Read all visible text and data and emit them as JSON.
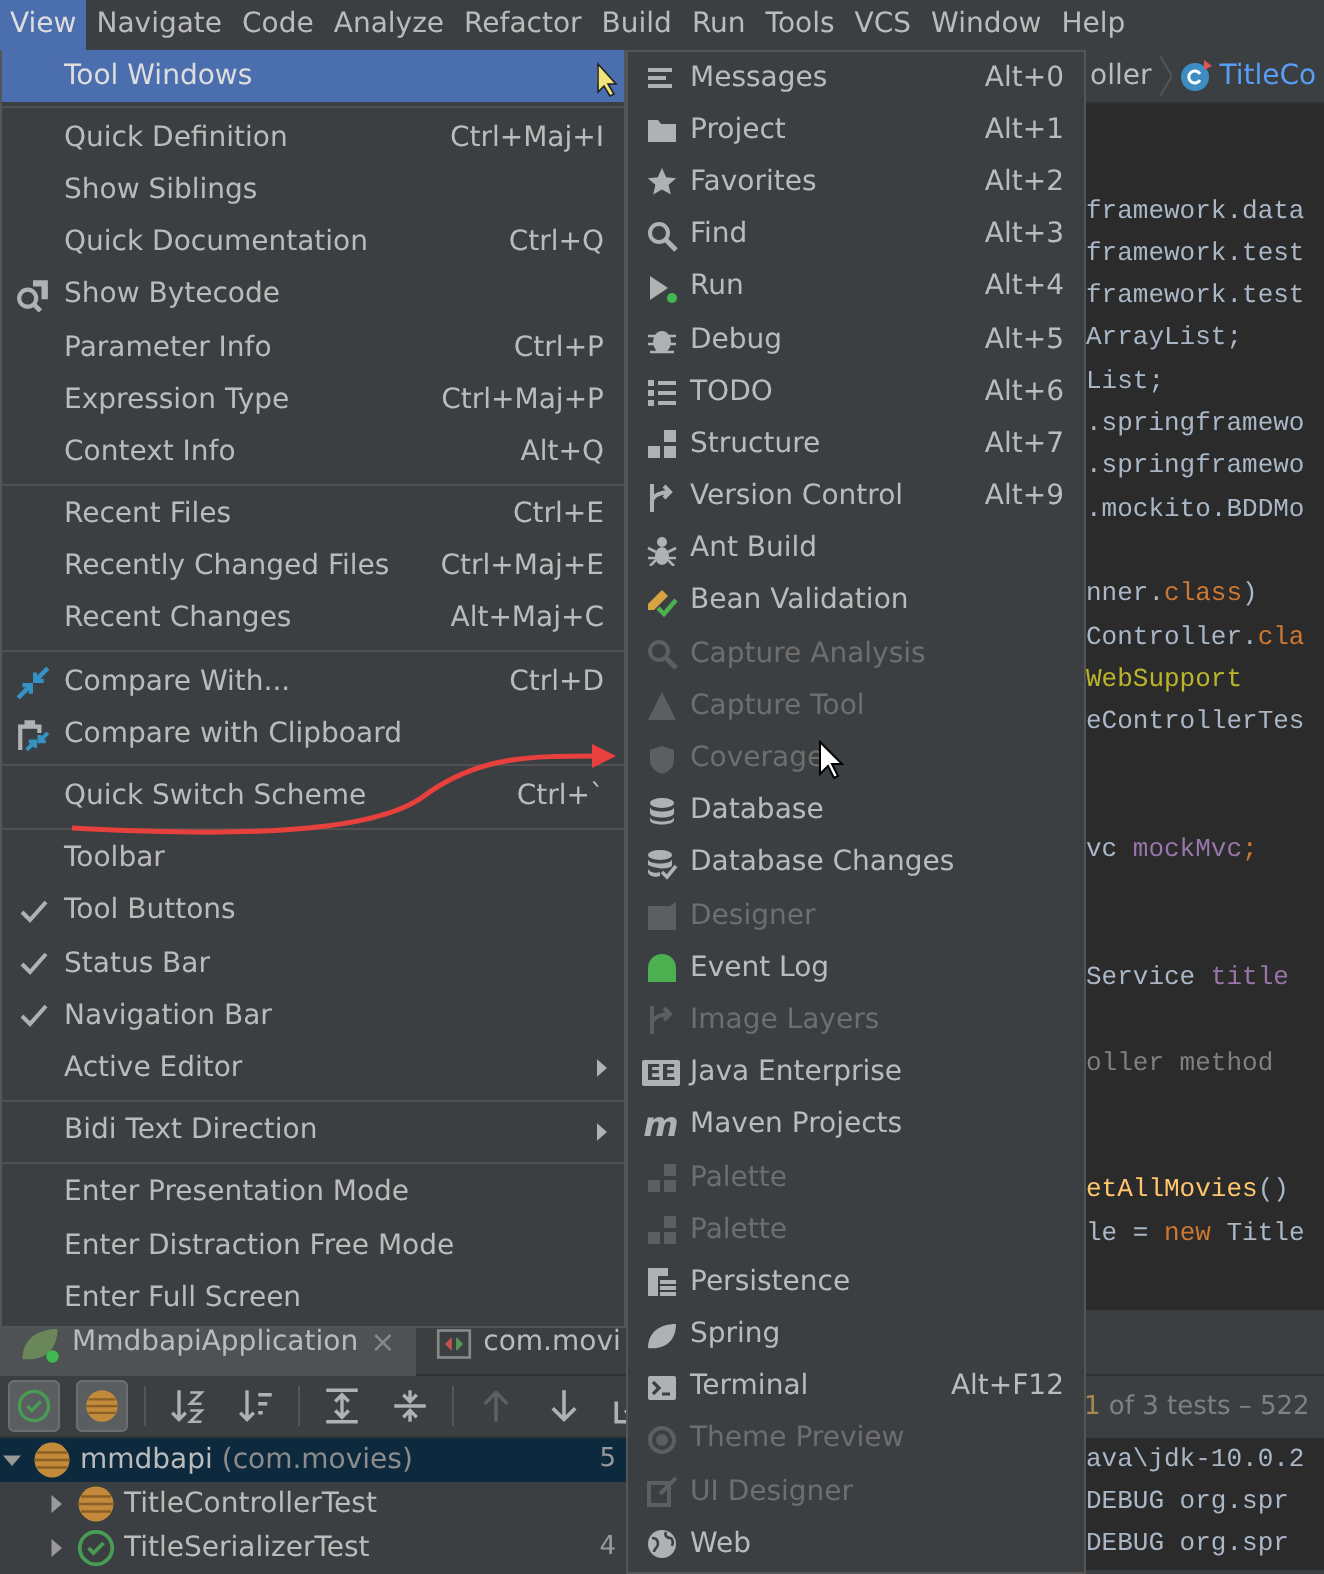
{
  "menu_bar": [
    {
      "label": "View",
      "selected": true
    },
    {
      "label": "Navigate",
      "selected": false
    },
    {
      "label": "Code",
      "selected": false
    },
    {
      "label": "Analyze",
      "selected": false
    },
    {
      "label": "Refactor",
      "selected": false
    },
    {
      "label": "Build",
      "selected": false
    },
    {
      "label": "Run",
      "selected": false
    },
    {
      "label": "Tools",
      "selected": false
    },
    {
      "label": "VCS",
      "selected": false
    },
    {
      "label": "Window",
      "selected": false
    },
    {
      "label": "Help",
      "selected": false
    }
  ],
  "view_menu": {
    "groups": [
      [
        {
          "label": "Tool Windows",
          "kind": "submenu",
          "selected": true
        }
      ],
      [
        {
          "label": "Quick Definition",
          "shortcut": "Ctrl+Maj+I",
          "kind": "action",
          "selected": false
        },
        {
          "label": "Show Siblings",
          "kind": "action",
          "selected": false
        },
        {
          "label": "Quick Documentation",
          "shortcut": "Ctrl+Q",
          "kind": "action",
          "selected": false
        },
        {
          "label": "Show Bytecode",
          "kind": "action",
          "selected": false
        },
        {
          "label": "Parameter Info",
          "shortcut": "Ctrl+P",
          "kind": "action",
          "selected": false
        },
        {
          "label": "Expression Type",
          "shortcut": "Ctrl+Maj+P",
          "kind": "action",
          "selected": false
        },
        {
          "label": "Context Info",
          "shortcut": "Alt+Q",
          "kind": "action",
          "selected": false
        }
      ],
      [
        {
          "label": "Recent Files",
          "shortcut": "Ctrl+E",
          "kind": "action",
          "selected": false
        },
        {
          "label": "Recently Changed Files",
          "shortcut": "Ctrl+Maj+E",
          "kind": "action",
          "selected": false
        },
        {
          "label": "Recent Changes",
          "shortcut": "Alt+Maj+C",
          "kind": "action",
          "selected": false
        }
      ],
      [
        {
          "label": "Compare With...",
          "shortcut": "Ctrl+D",
          "kind": "action",
          "selected": false
        },
        {
          "label": "Compare with Clipboard",
          "kind": "action",
          "selected": false
        }
      ],
      [
        {
          "label": "Quick Switch Scheme",
          "shortcut": "Ctrl+`",
          "kind": "action",
          "selected": false
        }
      ],
      [
        {
          "label": "Toolbar",
          "kind": "toggle",
          "checked": false,
          "selected": false
        },
        {
          "label": "Tool Buttons",
          "kind": "toggle",
          "checked": true,
          "selected": false
        },
        {
          "label": "Status Bar",
          "kind": "toggle",
          "checked": true,
          "selected": false
        },
        {
          "label": "Navigation Bar",
          "kind": "toggle",
          "checked": true,
          "selected": false
        },
        {
          "label": "Active Editor",
          "kind": "submenu",
          "selected": false
        }
      ],
      [
        {
          "label": "Bidi Text Direction",
          "kind": "submenu",
          "selected": false
        }
      ],
      [
        {
          "label": "Enter Presentation Mode",
          "kind": "action",
          "selected": false
        },
        {
          "label": "Enter Distraction Free Mode",
          "kind": "action",
          "selected": false
        },
        {
          "label": "Enter Full Screen",
          "kind": "action",
          "selected": false
        }
      ]
    ]
  },
  "tool_windows_menu": {
    "items": [
      {
        "label": "Messages",
        "shortcut": "Alt+0",
        "disabled": false
      },
      {
        "label": "Project",
        "shortcut": "Alt+1",
        "disabled": false
      },
      {
        "label": "Favorites",
        "shortcut": "Alt+2",
        "disabled": false
      },
      {
        "label": "Find",
        "shortcut": "Alt+3",
        "disabled": false
      },
      {
        "label": "Run",
        "shortcut": "Alt+4",
        "disabled": false
      },
      {
        "label": "Debug",
        "shortcut": "Alt+5",
        "disabled": false
      },
      {
        "label": "TODO",
        "shortcut": "Alt+6",
        "disabled": false
      },
      {
        "label": "Structure",
        "shortcut": "Alt+7",
        "disabled": false
      },
      {
        "label": "Version Control",
        "shortcut": "Alt+9",
        "disabled": false
      },
      {
        "label": "Ant Build",
        "disabled": false
      },
      {
        "label": "Bean Validation",
        "disabled": false
      },
      {
        "label": "Capture Analysis",
        "disabled": true
      },
      {
        "label": "Capture Tool",
        "disabled": true
      },
      {
        "label": "Coverage",
        "disabled": true
      },
      {
        "label": "Database",
        "disabled": false
      },
      {
        "label": "Database Changes",
        "disabled": false
      },
      {
        "label": "Designer",
        "disabled": true
      },
      {
        "label": "Event Log",
        "disabled": false
      },
      {
        "label": "Image Layers",
        "disabled": true
      },
      {
        "label": "Java Enterprise",
        "glyph": "EE",
        "disabled": false
      },
      {
        "label": "Maven Projects",
        "glyph": "m",
        "disabled": false
      },
      {
        "label": "Palette",
        "disabled": true
      },
      {
        "label": "Palette",
        "disabled": true
      },
      {
        "label": "Persistence",
        "disabled": false
      },
      {
        "label": "Spring",
        "disabled": false
      },
      {
        "label": "Terminal",
        "shortcut": "Alt+F12",
        "disabled": false
      },
      {
        "label": "Theme Preview",
        "disabled": true
      },
      {
        "label": "UI Designer",
        "disabled": true
      },
      {
        "label": "Web",
        "disabled": false
      }
    ]
  },
  "breadcrumb": [
    "oller",
    "TitleCo"
  ],
  "editor": {
    "lines": [
      {
        "blank": true
      },
      {
        "blank": true
      },
      {
        "segments": [
          {
            "text": "framework.data",
            "color": "#a9b7c6"
          }
        ]
      },
      {
        "segments": [
          {
            "text": "framework.test",
            "color": "#a9b7c6"
          }
        ]
      },
      {
        "segments": [
          {
            "text": "framework.test",
            "color": "#a9b7c6"
          }
        ]
      },
      {
        "segments": [
          {
            "text": "ArrayList;",
            "color": "#a9b7c6"
          }
        ]
      },
      {
        "segments": [
          {
            "text": "List;",
            "color": "#a9b7c6"
          }
        ]
      },
      {
        "segments": [
          {
            "text": ".springframewo",
            "color": "#a9b7c6"
          }
        ]
      },
      {
        "segments": [
          {
            "text": ".springframewo",
            "color": "#a9b7c6"
          }
        ]
      },
      {
        "segments": [
          {
            "text": ".mockito.BDDMo",
            "color": "#a9b7c6"
          }
        ]
      },
      {
        "blank": true
      },
      {
        "segments": [
          {
            "text": "nner.",
            "color": "#a9b7c6"
          },
          {
            "text": "class",
            "color": "#cc7832"
          },
          {
            "text": ")",
            "color": "#a9b7c6"
          }
        ]
      },
      {
        "segments": [
          {
            "text": "Controller.",
            "color": "#a9b7c6"
          },
          {
            "text": "cla",
            "color": "#cc7832"
          }
        ]
      },
      {
        "segments": [
          {
            "text": "WebSupport",
            "color": "#bbb529"
          }
        ]
      },
      {
        "segments": [
          {
            "text": "eControllerTes",
            "color": "#a9b7c6"
          }
        ]
      },
      {
        "blank": true
      },
      {
        "blank": true
      },
      {
        "segments": [
          {
            "text": "vc ",
            "color": "#a9b7c6"
          },
          {
            "text": "mockMvc",
            "color": "#9876aa"
          },
          {
            "text": ";",
            "color": "#cc7832"
          }
        ]
      },
      {
        "blank": true
      },
      {
        "blank": true
      },
      {
        "segments": [
          {
            "text": "Service ",
            "color": "#a9b7c6"
          },
          {
            "text": "title",
            "color": "#9876aa"
          }
        ]
      },
      {
        "blank": true
      },
      {
        "segments": [
          {
            "text": "oller method",
            "color": "#808080"
          }
        ]
      },
      {
        "blank": true
      },
      {
        "blank": true
      },
      {
        "segments": [
          {
            "text": "etAllMovies",
            "color": "#ffc66d"
          },
          {
            "text": "()",
            "color": "#a9b7c6"
          }
        ]
      },
      {
        "segments": [
          {
            "text": "le = ",
            "color": "#a9b7c6"
          },
          {
            "text": "new ",
            "color": "#cc7832"
          },
          {
            "text": "Title",
            "color": "#a9b7c6"
          }
        ]
      }
    ]
  },
  "run_panel": {
    "tabs": [
      {
        "label": "MmdbapiApplication",
        "close": "×",
        "selected": true
      },
      {
        "label": "com.movi",
        "selected": false
      }
    ],
    "toggles": [
      {
        "on": true
      },
      {
        "on": true
      }
    ],
    "status": [
      {
        "text": "1",
        "color": "#a68a4d"
      },
      {
        "text": " of 3 tests – 522",
        "color": "#808080"
      }
    ],
    "tree": [
      {
        "label": "mmdbapi",
        "detail": "(com.movies)",
        "value": "5",
        "kind": "ignored",
        "expanded": true,
        "selected": true,
        "children": [
          {
            "label": "TitleControllerTest",
            "kind": "ignored",
            "expanded": false,
            "selected": false
          },
          {
            "label": "TitleSerializerTest",
            "value": "4",
            "kind": "passed",
            "expanded": false,
            "selected": false
          }
        ]
      }
    ],
    "console": [
      "ava\\jdk-10.0.2",
      "DEBUG org.spr",
      "DEBUG org.spr"
    ]
  }
}
